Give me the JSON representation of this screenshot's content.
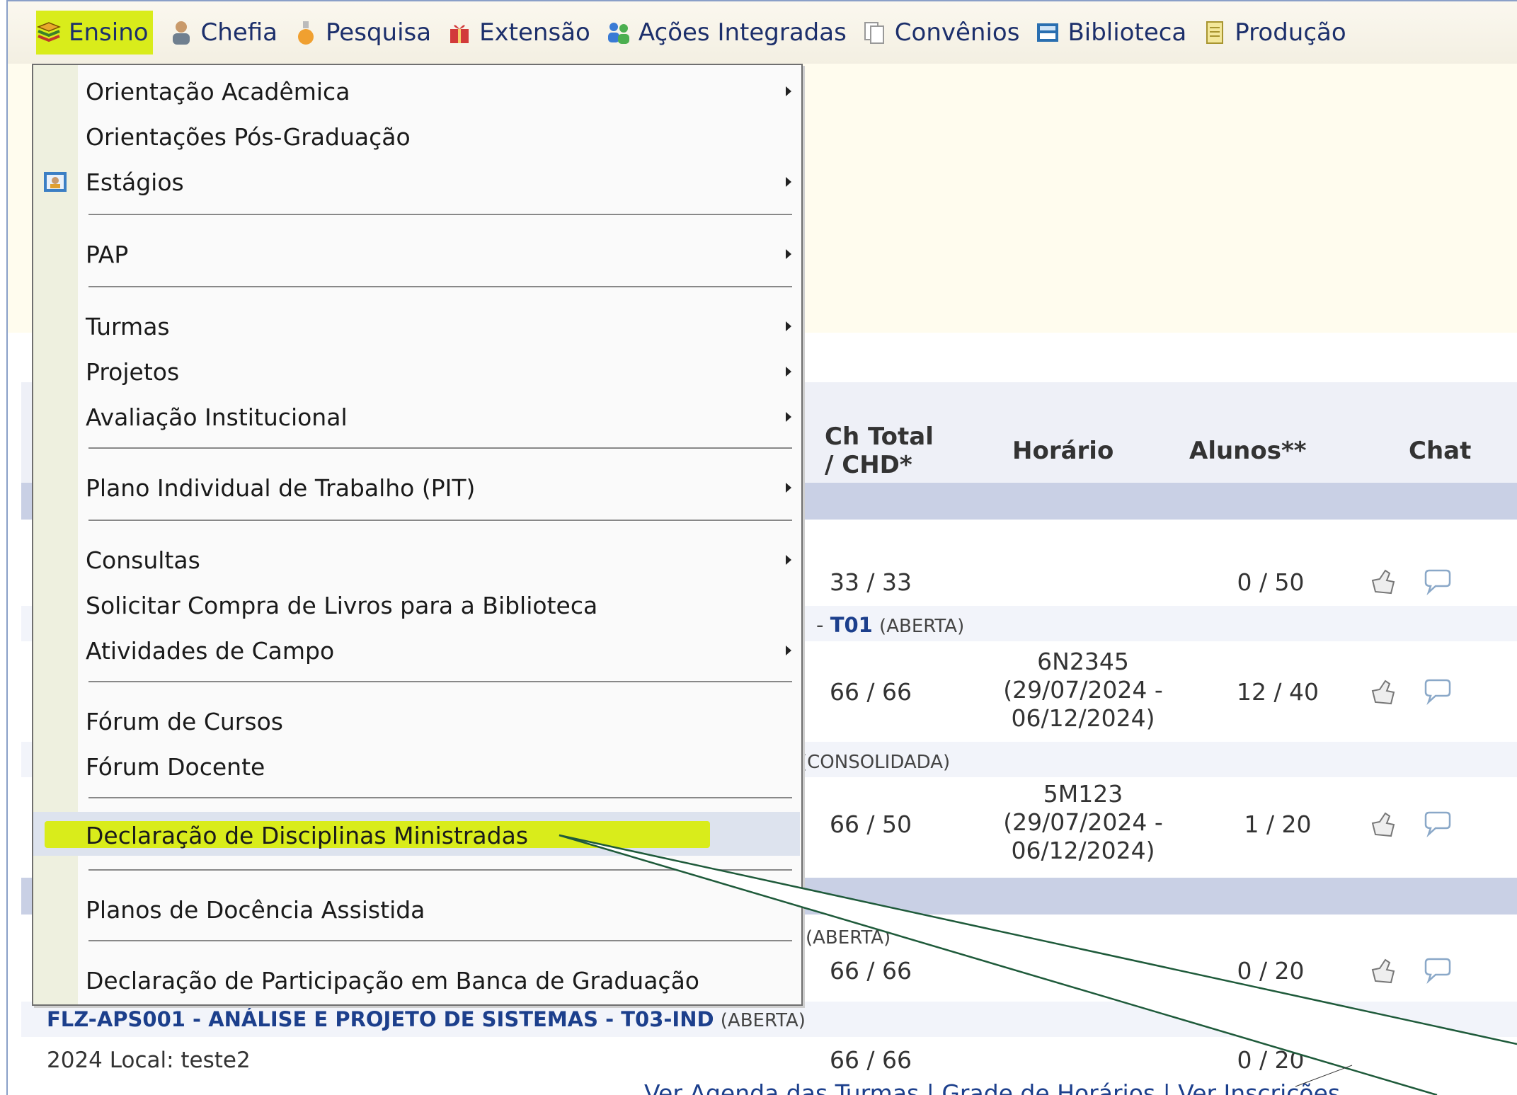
{
  "menubar": {
    "items": [
      {
        "label": "Ensino",
        "icon": "book-icon"
      },
      {
        "label": "Chefia",
        "icon": "person-icon"
      },
      {
        "label": "Pesquisa",
        "icon": "flask-icon"
      },
      {
        "label": "Extensão",
        "icon": "gift-icon"
      },
      {
        "label": "Ações Integradas",
        "icon": "people-icon"
      },
      {
        "label": "Convênios",
        "icon": "documents-icon"
      },
      {
        "label": "Biblioteca",
        "icon": "bookshelf-icon"
      },
      {
        "label": "Produção",
        "icon": "notepad-icon"
      }
    ]
  },
  "menu": {
    "items": [
      {
        "label": "Orientação Acadêmica",
        "submenu": true
      },
      {
        "label": "Orientações Pós-Graduação",
        "submenu": false
      },
      {
        "label": "Estágios",
        "submenu": true,
        "icon": "id-card-icon"
      },
      {
        "label": "PAP",
        "submenu": true
      },
      {
        "label": "Turmas",
        "submenu": true
      },
      {
        "label": "Projetos",
        "submenu": true
      },
      {
        "label": "Avaliação Institucional",
        "submenu": true
      },
      {
        "label": "Plano Individual de Trabalho (PIT)",
        "submenu": true
      },
      {
        "label": "Consultas",
        "submenu": true
      },
      {
        "label": "Solicitar Compra de Livros para a Biblioteca",
        "submenu": false
      },
      {
        "label": "Atividades de Campo",
        "submenu": true
      },
      {
        "label": "Fórum de Cursos",
        "submenu": false
      },
      {
        "label": "Fórum Docente",
        "submenu": false
      },
      {
        "label": "Declaração de Disciplinas Ministradas",
        "submenu": false,
        "highlighted": true
      },
      {
        "label": "Planos de Docência Assistida",
        "submenu": false
      },
      {
        "label": "Declaração de Participação em Banca de Graduação",
        "submenu": false
      }
    ]
  },
  "table": {
    "headers": {
      "ch": "Ch Total\n/ CHD*",
      "ch_line1": "Ch Total",
      "ch_line2": "/ CHD*",
      "horario": "Horário",
      "alunos": "Alunos**",
      "chat": "Chat"
    },
    "rows": [
      {
        "ch": "33 / 33",
        "horario": "",
        "alunos": "0 / 50"
      },
      {
        "title_code": "T01",
        "title_status": "(ABERTA)",
        "ch": "66 / 66",
        "horario1": "6N2345",
        "horario2": "(29/07/2024 -",
        "horario3": "06/12/2024)",
        "alunos": "12 / 40"
      },
      {
        "title_status": "(CONSOLIDADA)",
        "ch": "66 / 50",
        "horario1": "5M123",
        "horario2": "(29/07/2024 -",
        "horario3": "06/12/2024)",
        "alunos": "1 / 20"
      },
      {
        "title_status": "(ABERTA)",
        "ch": "66 / 66",
        "alunos": "0 / 20"
      },
      {
        "title_code": "FLZ-APS001 - ANÁLISE E PROJETO DE SISTEMAS - T03-IND",
        "title_status": "(ABERTA)",
        "subtitle": "2024 Local: teste2",
        "ch": "66 / 66",
        "alunos": "0 / 20"
      }
    ]
  },
  "bottom_links": "Ver Agenda das Turmas | Grade de Horários | Ver Inscrições"
}
